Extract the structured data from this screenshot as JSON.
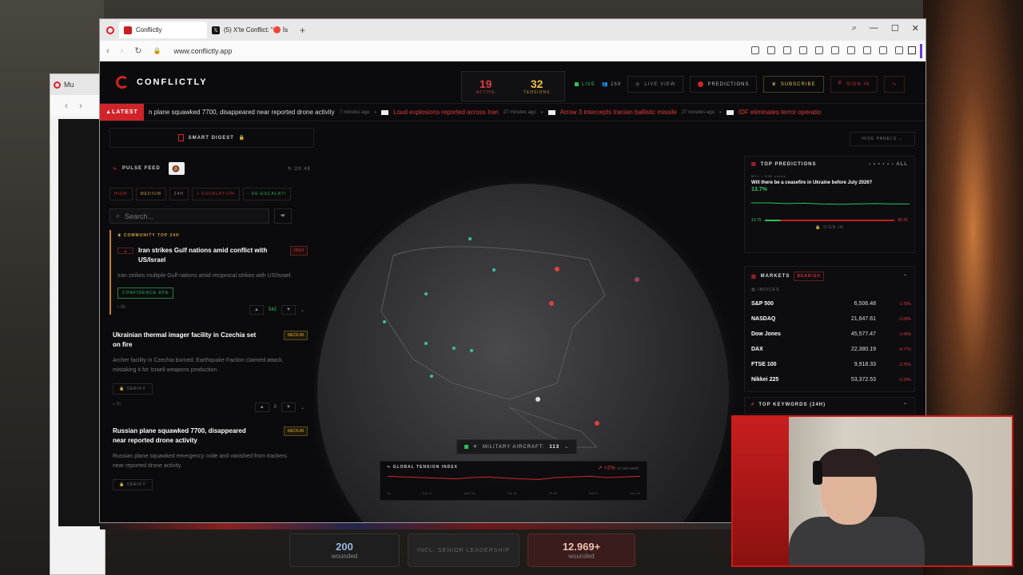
{
  "browser": {
    "tabs": [
      {
        "label": "Conflictly",
        "active": true
      },
      {
        "label": "(5) X'te Conflict: \"🔴 İsrail"
      }
    ],
    "url": "www.conflictly.app",
    "back_window_tab": "Mu"
  },
  "app": {
    "brand": "CONFLICTLY",
    "stats": {
      "active_value": "19",
      "active_label": "ACTIVE",
      "tensions_value": "32",
      "tensions_label": "TENSIONS"
    },
    "live_label": "LIVE",
    "users_count": "269",
    "live_view_label": "LIVE VIEW",
    "predictions_label": "PREDICTIONS",
    "subscribe_label": "SUBSCRIBE",
    "sign_in_label": "SIGN IN",
    "ticker": {
      "latest_label": "LATEST",
      "items": [
        {
          "text": "n plane squawked 7700, disappeared near reported drone activity",
          "ago": "7 minutes ago",
          "red": false
        },
        {
          "text": "Loud explosions reported across Iran",
          "ago": "27 minutes ago",
          "red": true
        },
        {
          "text": "Arrow 3 intercepts Iranian ballistic missile",
          "ago": "27 minutes ago",
          "red": true
        },
        {
          "text": "IDF eliminates terror operatio",
          "ago": "",
          "red": true
        }
      ]
    },
    "smart_digest_label": "SMART DIGEST",
    "pulse_feed": {
      "title": "PULSE FEED",
      "refresh_time": "20:46",
      "filters": [
        "HIGH",
        "MEDIUM",
        "24H",
        "+ ESCALATION",
        "- DE-ESCALATI"
      ],
      "search_placeholder": "Search...",
      "community_label": "COMMUNITY TOP 24H",
      "cards": [
        {
          "title": "Iran strikes Gulf nations amid conflict with US/Israel",
          "severity": "HIGH",
          "body": "Iran strikes multiple Gulf nations amid reciprocal strikes with US/Israel.",
          "confidence": "CONFIDENCE 95%",
          "votes": "542",
          "time": "8h"
        },
        {
          "title": "Ukrainian thermal imager facility in Czechia set on fire",
          "severity": "MEDIUM",
          "body": "Archer facility in Czechia burned; Earthquake Faction claimed attack, mistaking it for Israeli weapons production.",
          "verify": "VERIFY",
          "votes": "0",
          "time": "7h"
        },
        {
          "title": "Russian plane squawked 7700, disappeared near reported drone activity",
          "severity": "MEDIUM",
          "body": "Russian plane squawked emergency code and vanished from trackers near reported drone activity.",
          "verify": "VERIFY"
        }
      ]
    },
    "military_aircraft": {
      "label": "MILITARY AIRCRAFT:",
      "count": "113"
    },
    "tension_index": {
      "title": "GLOBAL TENSION INDEX",
      "change": "+2%",
      "change_suffix": "vs last week",
      "x_labels": [
        "16",
        "Tue 17",
        "Wed 18",
        "Thu 19",
        "Fri 20",
        "Sat 21",
        "Sun 22"
      ],
      "values": [
        62,
        61,
        60,
        59,
        58,
        60,
        61,
        59,
        58,
        57,
        60,
        61,
        62,
        60,
        61,
        62
      ]
    },
    "hide_panels_label": "HIDE PANELS",
    "predictions_panel": {
      "title": "TOP PREDICTIONS",
      "all_label": "ALL",
      "source": "M11",
      "votes": "836 votes",
      "question": "Will there be a ceasefire in Ukraine before July 2026?",
      "probability": "13.7%",
      "low": "13.75",
      "high": "86.25",
      "sign_in": "SIGN IN",
      "values": [
        14,
        14,
        13.8,
        13.9,
        13.7,
        13.6,
        13.7,
        13.8,
        13.7,
        13.7
      ]
    },
    "markets": {
      "title": "MARKETS",
      "sentiment": "BEARISH",
      "section": "INDICES",
      "rows": [
        {
          "name": "S&P 500",
          "value": "6,506.48",
          "change": "-1.78%"
        },
        {
          "name": "NASDAQ",
          "value": "21,647.61",
          "change": "-2.28%"
        },
        {
          "name": "Dow Jones",
          "value": "45,577.47",
          "change": "-1.40%"
        },
        {
          "name": "DAX",
          "value": "22,380.19",
          "change": "-4.77%"
        },
        {
          "name": "FTSE 100",
          "value": "9,918.33",
          "change": "-3.76%"
        },
        {
          "name": "Nikkei 225",
          "value": "53,372.53",
          "change": "-3.19%"
        }
      ]
    },
    "top_keywords": "TOP KEYWORDS (24H)"
  },
  "below": {
    "cards": [
      {
        "value": "200",
        "label": "wounded"
      },
      {
        "value": "",
        "label": "INCL. SENIOR LEADERSHIP"
      },
      {
        "value": "12.969+",
        "label": "wounded"
      }
    ]
  },
  "colors": {
    "accent": "#d0242a",
    "green": "#2ec05a",
    "gold": "#f0c040"
  }
}
